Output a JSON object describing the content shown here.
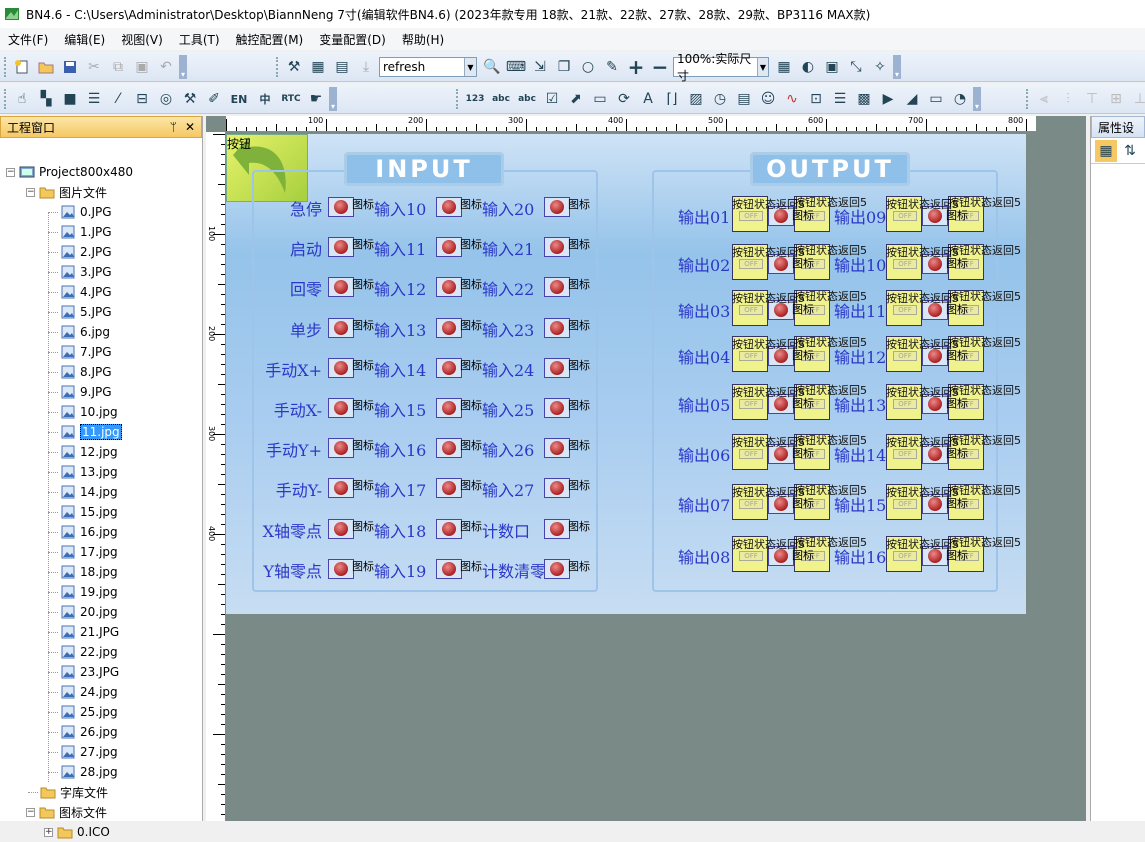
{
  "window": {
    "title": "BN4.6 - C:\\Users\\Administrator\\Desktop\\BiannNeng 7寸(编辑软件BN4.6) (2023年款专用 18款、21款、22款、27款、28款、29款、BP3116 MAX款)"
  },
  "menu": [
    "文件(F)",
    "编辑(E)",
    "视图(V)",
    "工具(T)",
    "触控配置(M)",
    "变量配置(D)",
    "帮助(H)"
  ],
  "toolbar": {
    "script_combo": "refresh",
    "zoom_combo": "100%:实际尺寸",
    "text_en": "EN",
    "text_zh": "中",
    "text_rtc": "RTC",
    "text_123": "123",
    "text_abc": "abc"
  },
  "left_panel": {
    "title": "工程窗口",
    "pin": "ᛘ",
    "close": "✕",
    "project": "Project800x480",
    "pictures_folder": "图片文件",
    "pictures": [
      "0.JPG",
      "1.JPG",
      "2.JPG",
      "3.JPG",
      "4.JPG",
      "5.JPG",
      "6.jpg",
      "7.JPG",
      "8.JPG",
      "9.JPG",
      "10.jpg",
      "11.jpg",
      "12.jpg",
      "13.jpg",
      "14.jpg",
      "15.jpg",
      "16.jpg",
      "17.jpg",
      "18.jpg",
      "19.jpg",
      "20.jpg",
      "21.JPG",
      "22.jpg",
      "23.JPG",
      "24.jpg",
      "25.jpg",
      "26.jpg",
      "27.jpg",
      "28.jpg"
    ],
    "selected": "11.jpg",
    "font_folder": "字库文件",
    "icon_folder": "图标文件",
    "icon_sub": "0.ICO"
  },
  "ruler": {
    "h": [
      "100",
      "200",
      "300",
      "400",
      "500",
      "600",
      "700",
      "800"
    ],
    "v": [
      "100",
      "200",
      "300",
      "400"
    ]
  },
  "canvas": {
    "corner_label": "按钮",
    "input_title": "INPUT",
    "output_title": "OUTPUT",
    "icon_text": "图标",
    "input_col1": [
      "急停",
      "启动",
      "回零",
      "单步",
      "手动X+",
      "手动X-",
      "手动Y+",
      "手动Y-",
      "X轴零点",
      "Y轴零点"
    ],
    "input_col2": [
      "输入10",
      "输入11",
      "输入12",
      "输入13",
      "输入14",
      "输入15",
      "输入16",
      "输入17",
      "输入18",
      "输入19"
    ],
    "input_col3": [
      "输入20",
      "输入21",
      "输入22",
      "输入23",
      "输入24",
      "输入25",
      "输入26",
      "输入27",
      "计数口",
      "计数清零"
    ],
    "output_col1": [
      "输出01",
      "输出02",
      "输出03",
      "输出04",
      "输出05",
      "输出06",
      "输出07",
      "输出08"
    ],
    "output_col2": [
      "输出09",
      "输出10",
      "输出11",
      "输出12",
      "输出13",
      "输出14",
      "输出15",
      "输出16"
    ],
    "btn_text": "按钮状态返回5",
    "off_text": "OFF"
  },
  "right_panel": {
    "title": "属性设"
  }
}
